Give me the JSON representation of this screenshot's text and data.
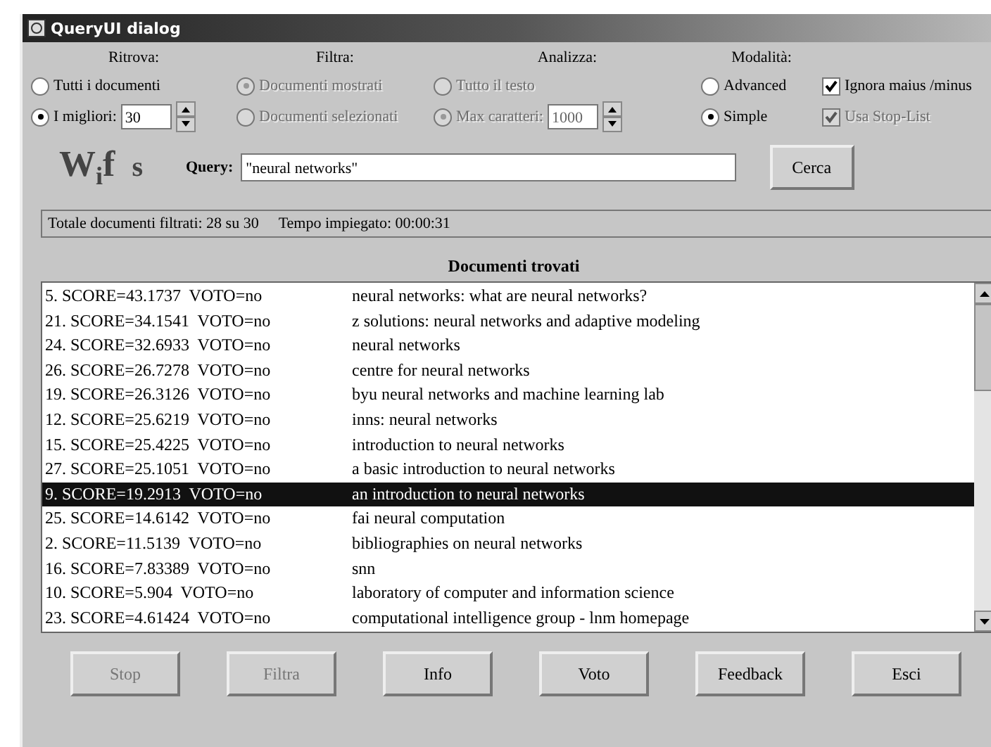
{
  "window": {
    "title": "QueryUI dialog"
  },
  "option_groups": [
    {
      "heading": "Ritrova:",
      "options": [
        {
          "kind": "radio",
          "label": "Tutti i documenti",
          "selected": false,
          "disabled": false
        },
        {
          "kind": "radio-spin",
          "label": "I migliori:",
          "value": "30",
          "selected": true,
          "disabled": false
        }
      ]
    },
    {
      "heading": "Filtra:",
      "options": [
        {
          "kind": "radio",
          "label": "Documenti mostrati",
          "selected": true,
          "disabled": true
        },
        {
          "kind": "radio",
          "label": "Documenti selezionati",
          "selected": false,
          "disabled": true
        }
      ]
    },
    {
      "heading": "Analizza:",
      "options": [
        {
          "kind": "radio",
          "label": "Tutto il testo",
          "selected": false,
          "disabled": true
        },
        {
          "kind": "radio-spin",
          "label": "Max caratteri:",
          "value": "1000",
          "selected": true,
          "disabled": true
        }
      ]
    },
    {
      "heading": "Modalità:",
      "options": [
        {
          "kind": "radio",
          "label": "Advanced",
          "selected": false,
          "disabled": false
        },
        {
          "kind": "radio",
          "label": "Simple",
          "selected": true,
          "disabled": false
        }
      ]
    },
    {
      "options": [
        {
          "kind": "checkbox",
          "label": "Ignora maius /minus",
          "checked": true,
          "disabled": false
        },
        {
          "kind": "checkbox",
          "label": "Usa Stop-List",
          "checked": true,
          "disabled": true
        }
      ]
    }
  ],
  "logo": {
    "main": "W",
    "sub": "i",
    "f": "f",
    "s": "s"
  },
  "query": {
    "label": "Query:",
    "value": "\"neural networks\"",
    "button": "Cerca"
  },
  "status": {
    "filtered": "Totale documenti filtrati: 28 su 30",
    "time": "Tempo impiegato: 00:00:31"
  },
  "results": {
    "heading": "Documenti trovati",
    "rows": [
      {
        "entry": "5. SCORE=43.1737  VOTO=no",
        "title": "neural networks: what are neural networks?",
        "selected": false
      },
      {
        "entry": "21. SCORE=34.1541  VOTO=no",
        "title": "z solutions: neural networks and adaptive modeling",
        "selected": false
      },
      {
        "entry": "24. SCORE=32.6933  VOTO=no",
        "title": "neural networks",
        "selected": false
      },
      {
        "entry": "26. SCORE=26.7278  VOTO=no",
        "title": "centre for neural networks",
        "selected": false
      },
      {
        "entry": "19. SCORE=26.3126  VOTO=no",
        "title": "byu neural networks and machine learning lab",
        "selected": false
      },
      {
        "entry": "12. SCORE=25.6219  VOTO=no",
        "title": "inns: neural networks",
        "selected": false
      },
      {
        "entry": "15. SCORE=25.4225  VOTO=no",
        "title": "introduction to neural networks",
        "selected": false
      },
      {
        "entry": "27. SCORE=25.1051  VOTO=no",
        "title": "a basic introduction to neural networks",
        "selected": false
      },
      {
        "entry": "9. SCORE=19.2913  VOTO=no",
        "title": "an introduction to neural networks",
        "selected": true
      },
      {
        "entry": "25. SCORE=14.6142  VOTO=no",
        "title": "fai neural computation",
        "selected": false
      },
      {
        "entry": "2. SCORE=11.5139  VOTO=no",
        "title": "bibliographies on neural networks",
        "selected": false
      },
      {
        "entry": "16. SCORE=7.83389  VOTO=no",
        "title": "snn",
        "selected": false
      },
      {
        "entry": "10. SCORE=5.904  VOTO=no",
        "title": "laboratory of computer and information science",
        "selected": false
      },
      {
        "entry": "23. SCORE=4.61424  VOTO=no",
        "title": "computational intelligence group - lnm homepage",
        "selected": false
      }
    ]
  },
  "buttons": [
    {
      "label": "Stop",
      "disabled": true
    },
    {
      "label": "Filtra",
      "disabled": true
    },
    {
      "label": "Info",
      "disabled": false
    },
    {
      "label": "Voto",
      "disabled": false
    },
    {
      "label": "Feedback",
      "disabled": false
    },
    {
      "label": "Esci",
      "disabled": false
    }
  ]
}
